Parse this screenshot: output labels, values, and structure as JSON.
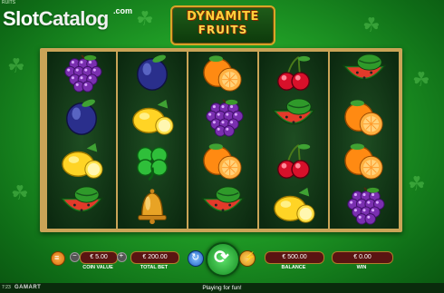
{
  "header": {
    "corner_text": "RUITS",
    "watermark": {
      "part1": "Slot",
      "part2": "Catalog",
      "suffix": ".com"
    },
    "game_title": {
      "line1": "DYNAMITE",
      "line2": "FRUITS"
    }
  },
  "reels": [
    [
      "grapes",
      "plum",
      "lemon",
      "watermelon"
    ],
    [
      "plum",
      "lemon",
      "clover",
      "bell"
    ],
    [
      "orange",
      "grapes",
      "orange",
      "watermelon"
    ],
    [
      "cherry",
      "watermelon",
      "cherry",
      "lemon"
    ],
    [
      "watermelon",
      "orange",
      "orange",
      "grapes"
    ]
  ],
  "controls": {
    "coin_value": {
      "value": "€ 5.00",
      "label": "COIN VALUE"
    },
    "total_bet": {
      "value": "€ 200.00",
      "label": "TOTAL BET"
    },
    "balance": {
      "value": "€ 500.00",
      "label": "BALANCE"
    },
    "win": {
      "value": "€ 0.00",
      "label": "WIN"
    }
  },
  "status": {
    "message": "Playing for fun!",
    "time": "7:23",
    "brand": "GAMART"
  },
  "colors": {
    "background": "#1f9a25",
    "frame": "#c9a457",
    "pill": "#5a1412"
  },
  "icons": [
    "menu-icon",
    "decrease-icon",
    "increase-icon",
    "autoplay-icon",
    "spin-icon",
    "turbo-icon",
    "clover-icon"
  ]
}
